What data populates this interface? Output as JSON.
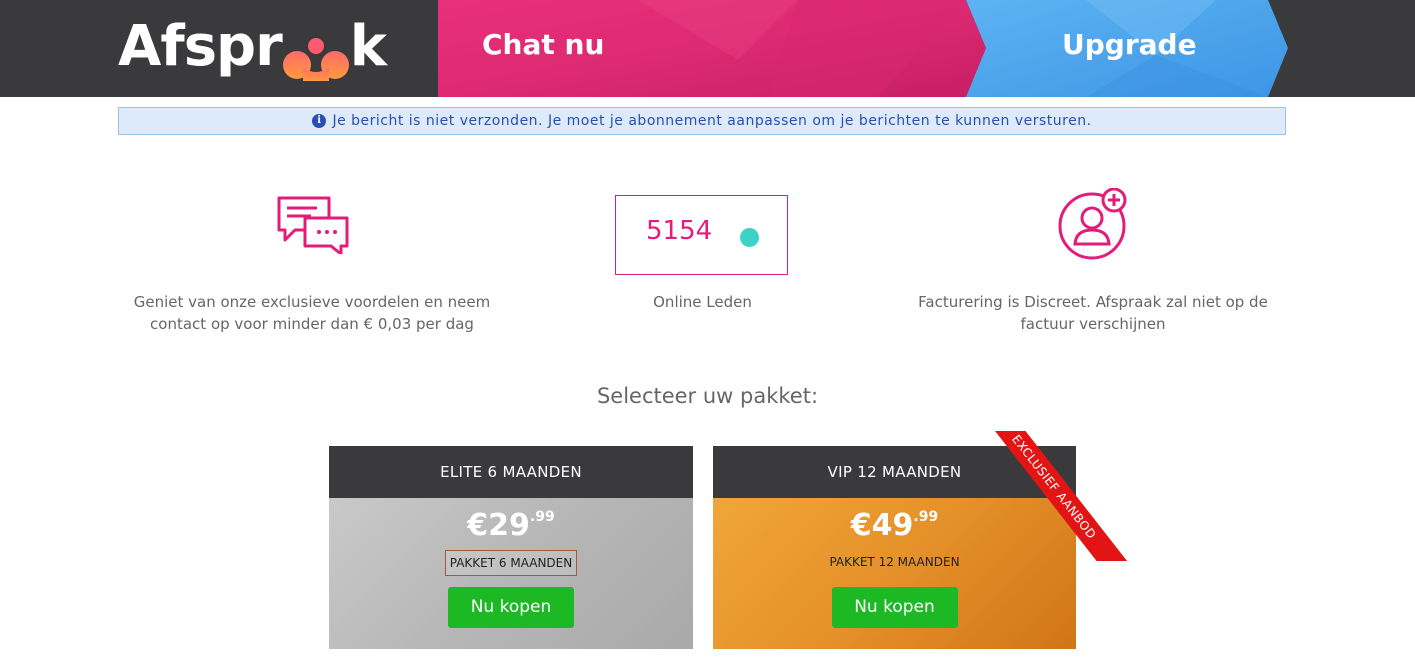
{
  "header": {
    "logo_text_left": "Afspr",
    "logo_text_right": "k",
    "nav": [
      {
        "label": "Chat nu",
        "color": "#e0256f"
      },
      {
        "label": "Upgrade",
        "color": "#4fa8ec"
      }
    ]
  },
  "alert": {
    "text": "Je bericht is niet verzonden. Je moet je abonnement aanpassen om je berichten te kunnen versturen.",
    "icon": "info-icon"
  },
  "features": {
    "chat": {
      "icon": "chat-bubbles-icon",
      "text": "Geniet van onze exclusieve voordelen en neem contact op voor minder dan € 0,03 per dag"
    },
    "online": {
      "count": "5154",
      "label": "Online Leden",
      "status_color": "#3ed2c5"
    },
    "billing": {
      "icon": "user-add-icon",
      "text": "Facturering is Discreet. Afspraak zal niet op de factuur verschijnen"
    }
  },
  "select_title": "Selecteer uw pakket:",
  "packages": [
    {
      "title": "ELITE 6 MAANDEN",
      "price": "€29",
      "cents": ".99",
      "subtitle": "PAKKET 6 MAANDEN",
      "button": "Nu kopen"
    },
    {
      "title": "VIP 12 MAANDEN",
      "price": "€49",
      "cents": ".99",
      "subtitle": "PAKKET 12 MAANDEN",
      "button": "Nu kopen",
      "ribbon": "EXCLUSIEF AANBOD"
    }
  ],
  "colors": {
    "accent": "#e31c79",
    "buy": "#1db924",
    "header": "#3a3a3d"
  }
}
